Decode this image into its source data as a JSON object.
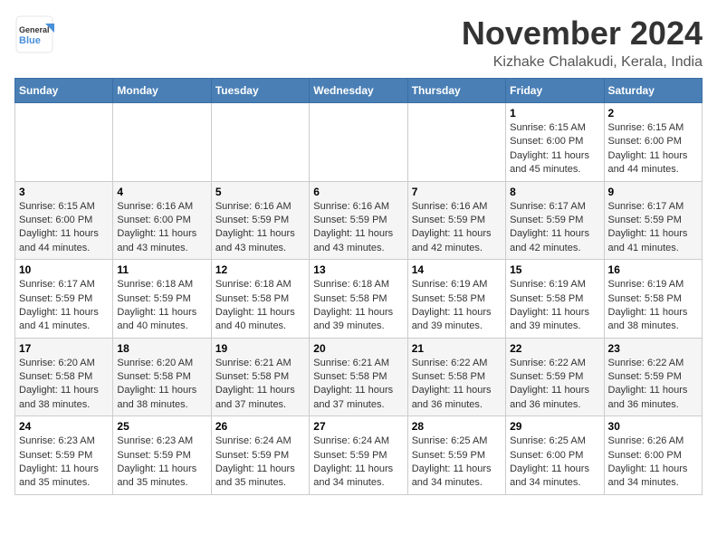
{
  "header": {
    "logo_general": "General",
    "logo_blue": "Blue",
    "month_title": "November 2024",
    "subtitle": "Kizhake Chalakudi, Kerala, India"
  },
  "days_of_week": [
    "Sunday",
    "Monday",
    "Tuesday",
    "Wednesday",
    "Thursday",
    "Friday",
    "Saturday"
  ],
  "weeks": [
    [
      {
        "day": "",
        "info": ""
      },
      {
        "day": "",
        "info": ""
      },
      {
        "day": "",
        "info": ""
      },
      {
        "day": "",
        "info": ""
      },
      {
        "day": "",
        "info": ""
      },
      {
        "day": "1",
        "info": "Sunrise: 6:15 AM\nSunset: 6:00 PM\nDaylight: 11 hours and 45 minutes."
      },
      {
        "day": "2",
        "info": "Sunrise: 6:15 AM\nSunset: 6:00 PM\nDaylight: 11 hours and 44 minutes."
      }
    ],
    [
      {
        "day": "3",
        "info": "Sunrise: 6:15 AM\nSunset: 6:00 PM\nDaylight: 11 hours and 44 minutes."
      },
      {
        "day": "4",
        "info": "Sunrise: 6:16 AM\nSunset: 6:00 PM\nDaylight: 11 hours and 43 minutes."
      },
      {
        "day": "5",
        "info": "Sunrise: 6:16 AM\nSunset: 5:59 PM\nDaylight: 11 hours and 43 minutes."
      },
      {
        "day": "6",
        "info": "Sunrise: 6:16 AM\nSunset: 5:59 PM\nDaylight: 11 hours and 43 minutes."
      },
      {
        "day": "7",
        "info": "Sunrise: 6:16 AM\nSunset: 5:59 PM\nDaylight: 11 hours and 42 minutes."
      },
      {
        "day": "8",
        "info": "Sunrise: 6:17 AM\nSunset: 5:59 PM\nDaylight: 11 hours and 42 minutes."
      },
      {
        "day": "9",
        "info": "Sunrise: 6:17 AM\nSunset: 5:59 PM\nDaylight: 11 hours and 41 minutes."
      }
    ],
    [
      {
        "day": "10",
        "info": "Sunrise: 6:17 AM\nSunset: 5:59 PM\nDaylight: 11 hours and 41 minutes."
      },
      {
        "day": "11",
        "info": "Sunrise: 6:18 AM\nSunset: 5:59 PM\nDaylight: 11 hours and 40 minutes."
      },
      {
        "day": "12",
        "info": "Sunrise: 6:18 AM\nSunset: 5:58 PM\nDaylight: 11 hours and 40 minutes."
      },
      {
        "day": "13",
        "info": "Sunrise: 6:18 AM\nSunset: 5:58 PM\nDaylight: 11 hours and 39 minutes."
      },
      {
        "day": "14",
        "info": "Sunrise: 6:19 AM\nSunset: 5:58 PM\nDaylight: 11 hours and 39 minutes."
      },
      {
        "day": "15",
        "info": "Sunrise: 6:19 AM\nSunset: 5:58 PM\nDaylight: 11 hours and 39 minutes."
      },
      {
        "day": "16",
        "info": "Sunrise: 6:19 AM\nSunset: 5:58 PM\nDaylight: 11 hours and 38 minutes."
      }
    ],
    [
      {
        "day": "17",
        "info": "Sunrise: 6:20 AM\nSunset: 5:58 PM\nDaylight: 11 hours and 38 minutes."
      },
      {
        "day": "18",
        "info": "Sunrise: 6:20 AM\nSunset: 5:58 PM\nDaylight: 11 hours and 38 minutes."
      },
      {
        "day": "19",
        "info": "Sunrise: 6:21 AM\nSunset: 5:58 PM\nDaylight: 11 hours and 37 minutes."
      },
      {
        "day": "20",
        "info": "Sunrise: 6:21 AM\nSunset: 5:58 PM\nDaylight: 11 hours and 37 minutes."
      },
      {
        "day": "21",
        "info": "Sunrise: 6:22 AM\nSunset: 5:58 PM\nDaylight: 11 hours and 36 minutes."
      },
      {
        "day": "22",
        "info": "Sunrise: 6:22 AM\nSunset: 5:59 PM\nDaylight: 11 hours and 36 minutes."
      },
      {
        "day": "23",
        "info": "Sunrise: 6:22 AM\nSunset: 5:59 PM\nDaylight: 11 hours and 36 minutes."
      }
    ],
    [
      {
        "day": "24",
        "info": "Sunrise: 6:23 AM\nSunset: 5:59 PM\nDaylight: 11 hours and 35 minutes."
      },
      {
        "day": "25",
        "info": "Sunrise: 6:23 AM\nSunset: 5:59 PM\nDaylight: 11 hours and 35 minutes."
      },
      {
        "day": "26",
        "info": "Sunrise: 6:24 AM\nSunset: 5:59 PM\nDaylight: 11 hours and 35 minutes."
      },
      {
        "day": "27",
        "info": "Sunrise: 6:24 AM\nSunset: 5:59 PM\nDaylight: 11 hours and 34 minutes."
      },
      {
        "day": "28",
        "info": "Sunrise: 6:25 AM\nSunset: 5:59 PM\nDaylight: 11 hours and 34 minutes."
      },
      {
        "day": "29",
        "info": "Sunrise: 6:25 AM\nSunset: 6:00 PM\nDaylight: 11 hours and 34 minutes."
      },
      {
        "day": "30",
        "info": "Sunrise: 6:26 AM\nSunset: 6:00 PM\nDaylight: 11 hours and 34 minutes."
      }
    ]
  ]
}
